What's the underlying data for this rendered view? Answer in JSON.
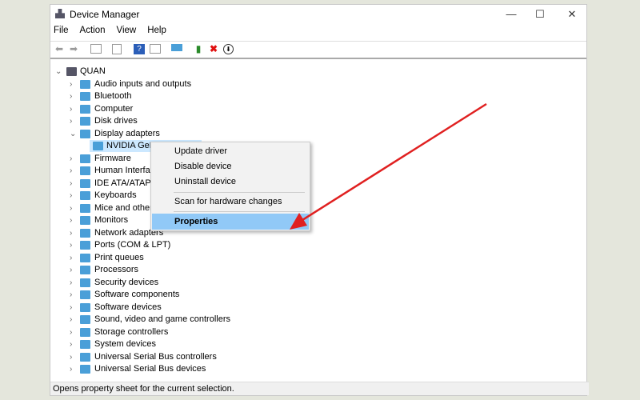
{
  "window": {
    "title": "Device Manager",
    "controls": [
      "—",
      "☐",
      "✕"
    ]
  },
  "menu": [
    "File",
    "Action",
    "View",
    "Help"
  ],
  "toolbar": [
    "back-icon",
    "forward-icon",
    "show-hide-console-tree-icon",
    "properties-icon",
    "help-icon",
    "action-pane-icon",
    "scan-hardware-icon",
    "update-driver-icon",
    "uninstall-icon",
    "disable-icon"
  ],
  "tree": {
    "root": "QUAN",
    "items": [
      {
        "label": "Audio inputs and outputs",
        "expanded": false
      },
      {
        "label": "Bluetooth",
        "expanded": false
      },
      {
        "label": "Computer",
        "expanded": false
      },
      {
        "label": "Disk drives",
        "expanded": false
      },
      {
        "label": "Display adapters",
        "expanded": true,
        "children": [
          "NVIDIA GeForce RTX 2060"
        ]
      },
      {
        "label": "Firmware"
      },
      {
        "label": "Human Interface Devices"
      },
      {
        "label": "IDE ATA/ATAPI controllers"
      },
      {
        "label": "Keyboards"
      },
      {
        "label": "Mice and other pointing devices"
      },
      {
        "label": "Monitors"
      },
      {
        "label": "Network adapters"
      },
      {
        "label": "Ports (COM & LPT)"
      },
      {
        "label": "Print queues"
      },
      {
        "label": "Processors"
      },
      {
        "label": "Security devices"
      },
      {
        "label": "Software components"
      },
      {
        "label": "Software devices"
      },
      {
        "label": "Sound, video and game controllers"
      },
      {
        "label": "Storage controllers"
      },
      {
        "label": "System devices"
      },
      {
        "label": "Universal Serial Bus controllers"
      },
      {
        "label": "Universal Serial Bus devices"
      }
    ]
  },
  "context_menu": {
    "items": [
      "Update driver",
      "Disable device",
      "Uninstall device",
      "Scan for hardware changes",
      "Properties"
    ],
    "highlighted": "Properties"
  },
  "status": "Opens property sheet for the current selection.",
  "colors": {
    "annotation_arrow": "#e02020",
    "highlight": "#91c9f7"
  }
}
